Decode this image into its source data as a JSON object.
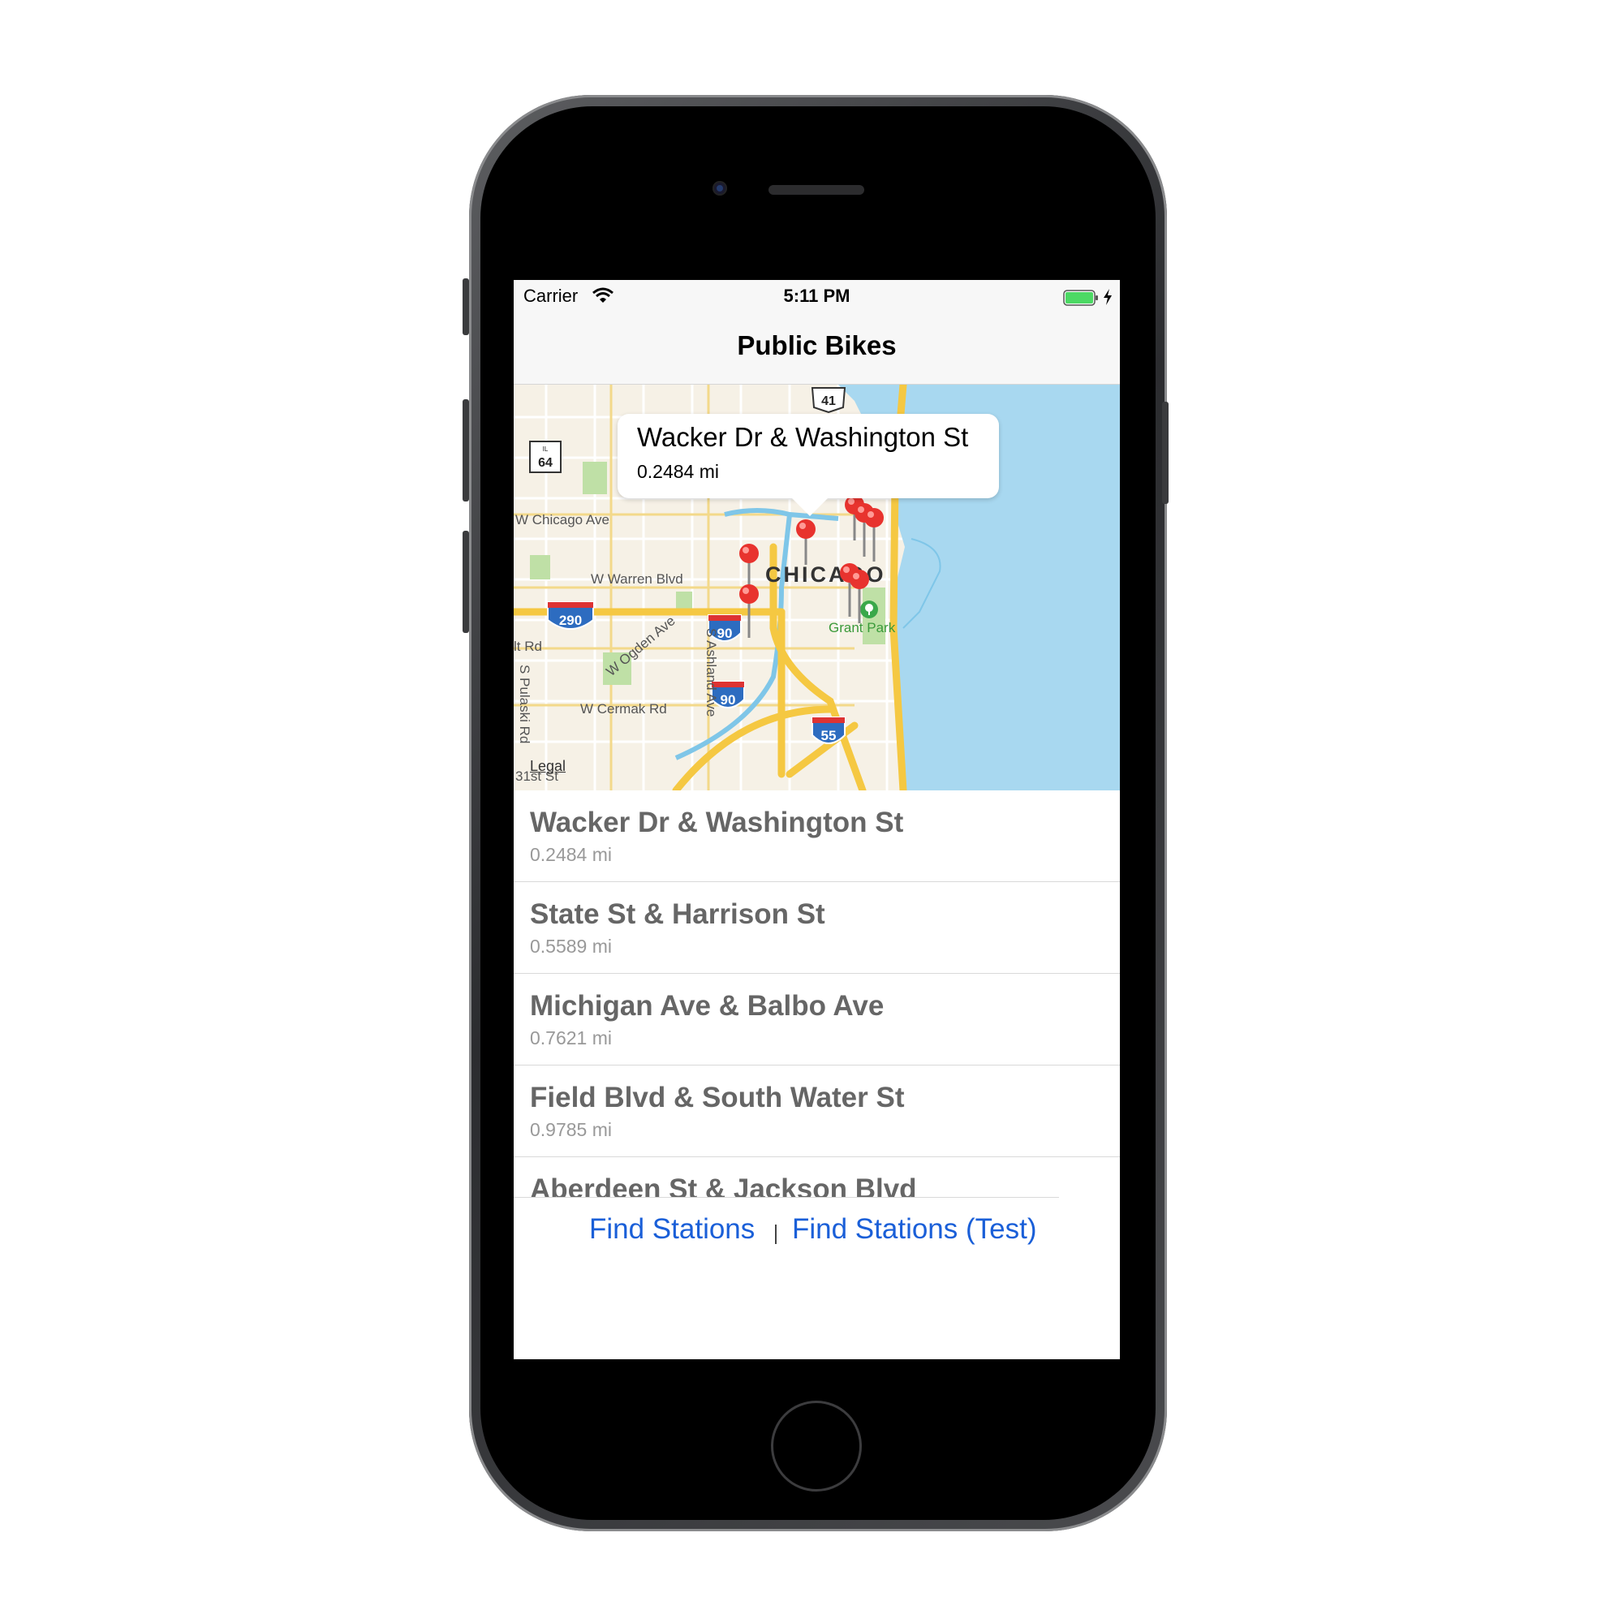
{
  "status_bar": {
    "carrier": "Carrier",
    "time": "5:11 PM"
  },
  "nav": {
    "title": "Public Bikes"
  },
  "map": {
    "callout": {
      "title": "Wacker Dr & Washington St",
      "subtitle": "0.2484 mi"
    },
    "labels": {
      "w_chicago_ave": "W Chicago Ave",
      "w_warren_blvd": "W Warren Blvd",
      "chicago": "CHICAGO",
      "grant_park": "Grant Park",
      "w_ogden_ave": "W Ogden Ave",
      "s_ashland_ave": "S Ashland Ave",
      "w_cermak_rd": "W Cermak Rd",
      "s_pulaski_rd": "S Pulaski Rd",
      "lt_rd": "lt Rd",
      "st_31": "31st St",
      "legal": "Legal"
    },
    "shields": {
      "i290": "290",
      "i90a": "90",
      "i90b": "90",
      "i55": "55",
      "us41": "41",
      "il64": "64",
      "il_prefix": "IL"
    }
  },
  "stations": [
    {
      "name": "Wacker Dr & Washington St",
      "distance": "0.2484 mi"
    },
    {
      "name": "State St & Harrison St",
      "distance": "0.5589 mi"
    },
    {
      "name": "Michigan Ave & Balbo Ave",
      "distance": "0.7621 mi"
    },
    {
      "name": "Field Blvd & South Water St",
      "distance": "0.9785 mi"
    },
    {
      "name": "Aberdeen St & Jackson Blvd",
      "distance": ""
    }
  ],
  "actions": {
    "find_stations": "Find Stations",
    "find_stations_test": "Find Stations (Test)"
  },
  "colors": {
    "water": "#a8d8f0",
    "land": "#f6f1e6",
    "park": "#bfe0a6",
    "highway": "#f5c842",
    "pin": "#e8332e",
    "link": "#1a5fd8"
  }
}
